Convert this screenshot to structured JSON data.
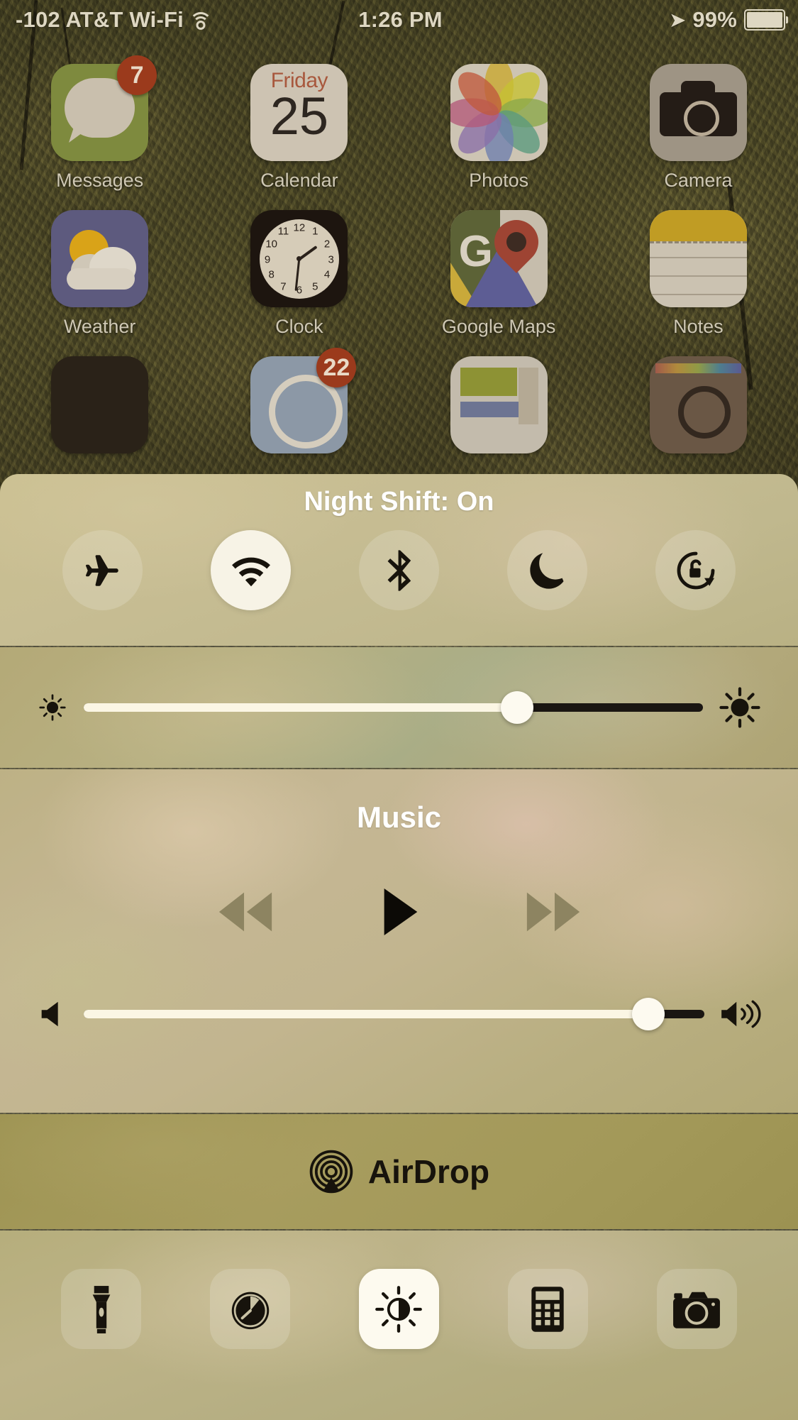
{
  "status_bar": {
    "signal_text": "-102 AT&T Wi-Fi",
    "wifi_icon": "wifi-icon",
    "time": "1:26 PM",
    "location_icon": "location-arrow-icon",
    "battery_percent": "99%",
    "battery_icon": "battery-icon"
  },
  "home_screen": {
    "row1": [
      {
        "label": "Messages",
        "icon": "messages-icon",
        "badge": "7"
      },
      {
        "label": "Calendar",
        "icon": "calendar-icon",
        "day": "Friday",
        "date": "25"
      },
      {
        "label": "Photos",
        "icon": "photos-icon"
      },
      {
        "label": "Camera",
        "icon": "camera-icon"
      }
    ],
    "row2": [
      {
        "label": "Weather",
        "icon": "weather-icon"
      },
      {
        "label": "Clock",
        "icon": "clock-icon"
      },
      {
        "label": "Google Maps",
        "icon": "google-maps-icon",
        "glyph": "G"
      },
      {
        "label": "Notes",
        "icon": "notes-icon"
      }
    ],
    "row3": [
      {
        "label": "",
        "icon": "books-icon"
      },
      {
        "label": "",
        "icon": "podcasts-icon",
        "badge": "22"
      },
      {
        "label": "",
        "icon": "news-icon"
      },
      {
        "label": "",
        "icon": "instagram-icon"
      }
    ]
  },
  "control_center": {
    "title": "Night Shift: On",
    "toggles": [
      {
        "name": "airplane-mode",
        "icon": "airplane-icon",
        "state": "off"
      },
      {
        "name": "wifi",
        "icon": "wifi-icon",
        "state": "on"
      },
      {
        "name": "bluetooth",
        "icon": "bluetooth-icon",
        "state": "off"
      },
      {
        "name": "do-not-disturb",
        "icon": "moon-icon",
        "state": "off"
      },
      {
        "name": "rotation-lock",
        "icon": "rotation-lock-icon",
        "state": "off"
      }
    ],
    "brightness": {
      "label": "Brightness",
      "value_percent": 70,
      "min_icon": "brightness-low-icon",
      "max_icon": "brightness-high-icon"
    },
    "music": {
      "title": "Music",
      "controls": [
        {
          "name": "previous",
          "icon": "rewind-icon",
          "state": "dim"
        },
        {
          "name": "play",
          "icon": "play-icon",
          "state": "active"
        },
        {
          "name": "next",
          "icon": "fast-forward-icon",
          "state": "dim"
        }
      ],
      "volume": {
        "label": "Volume",
        "value_percent": 91,
        "min_icon": "speaker-icon",
        "max_icon": "speaker-wave-icon"
      }
    },
    "airdrop": {
      "label": "AirDrop",
      "icon": "airdrop-icon"
    },
    "shortcuts": [
      {
        "name": "flashlight",
        "icon": "flashlight-icon",
        "state": "off"
      },
      {
        "name": "timer",
        "icon": "timer-icon",
        "state": "off"
      },
      {
        "name": "night-shift",
        "icon": "night-shift-icon",
        "state": "on"
      },
      {
        "name": "calculator",
        "icon": "calculator-icon",
        "state": "off"
      },
      {
        "name": "camera",
        "icon": "camera-icon",
        "state": "off"
      }
    ]
  },
  "colors": {
    "accent_on": "#fdfaef",
    "icon_dark": "#17130c",
    "title_text": "#ffffff",
    "badge_bg": "#9b3a1c"
  }
}
